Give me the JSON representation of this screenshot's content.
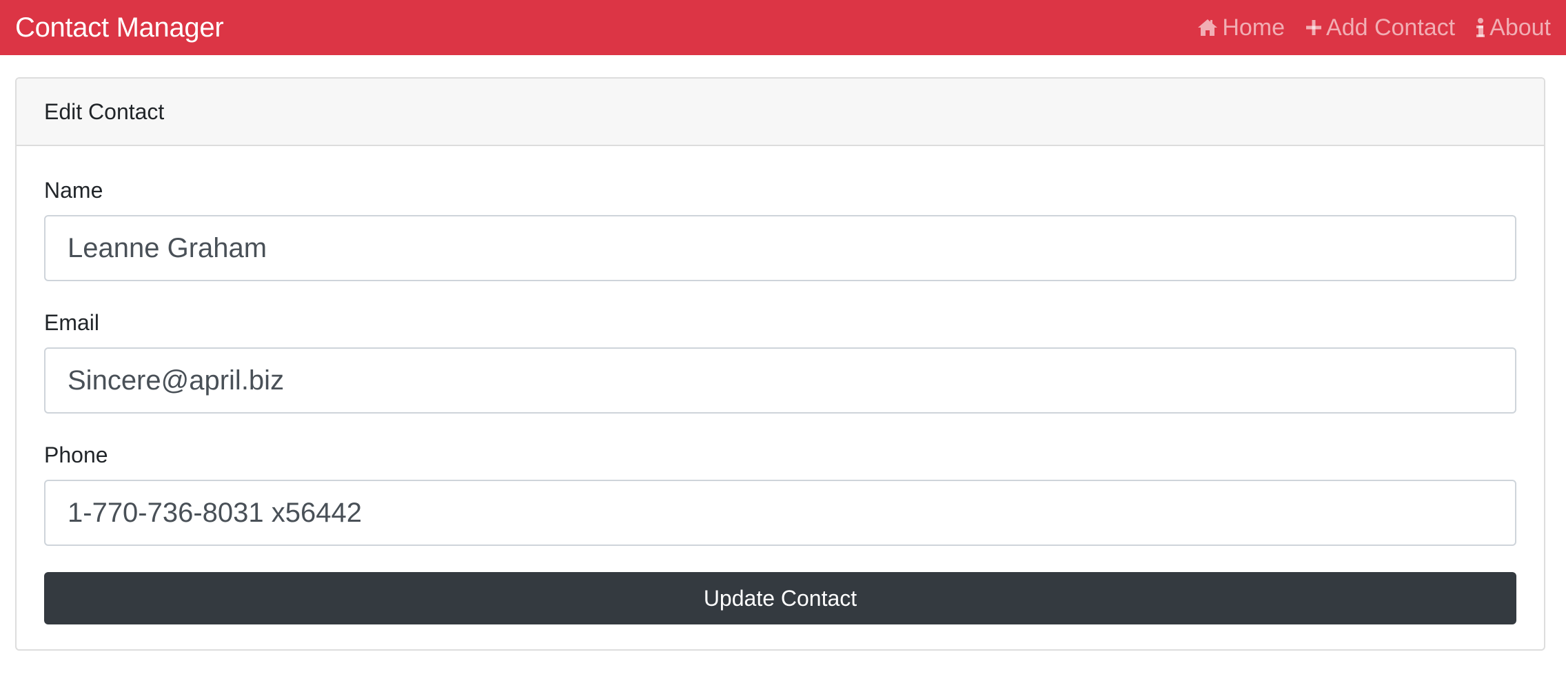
{
  "navbar": {
    "brand": "Contact Manager",
    "background": "#dc3545",
    "links": [
      {
        "icon": "home-icon",
        "label": "Home"
      },
      {
        "icon": "plus-icon",
        "label": "Add Contact"
      },
      {
        "icon": "info-icon",
        "label": "About"
      }
    ]
  },
  "card": {
    "header": "Edit Contact",
    "fields": [
      {
        "label": "Name",
        "value": "Leanne Graham"
      },
      {
        "label": "Email",
        "value": "Sincere@april.biz"
      },
      {
        "label": "Phone",
        "value": "1-770-736-8031 x56442"
      }
    ],
    "submit_label": "Update Contact"
  }
}
